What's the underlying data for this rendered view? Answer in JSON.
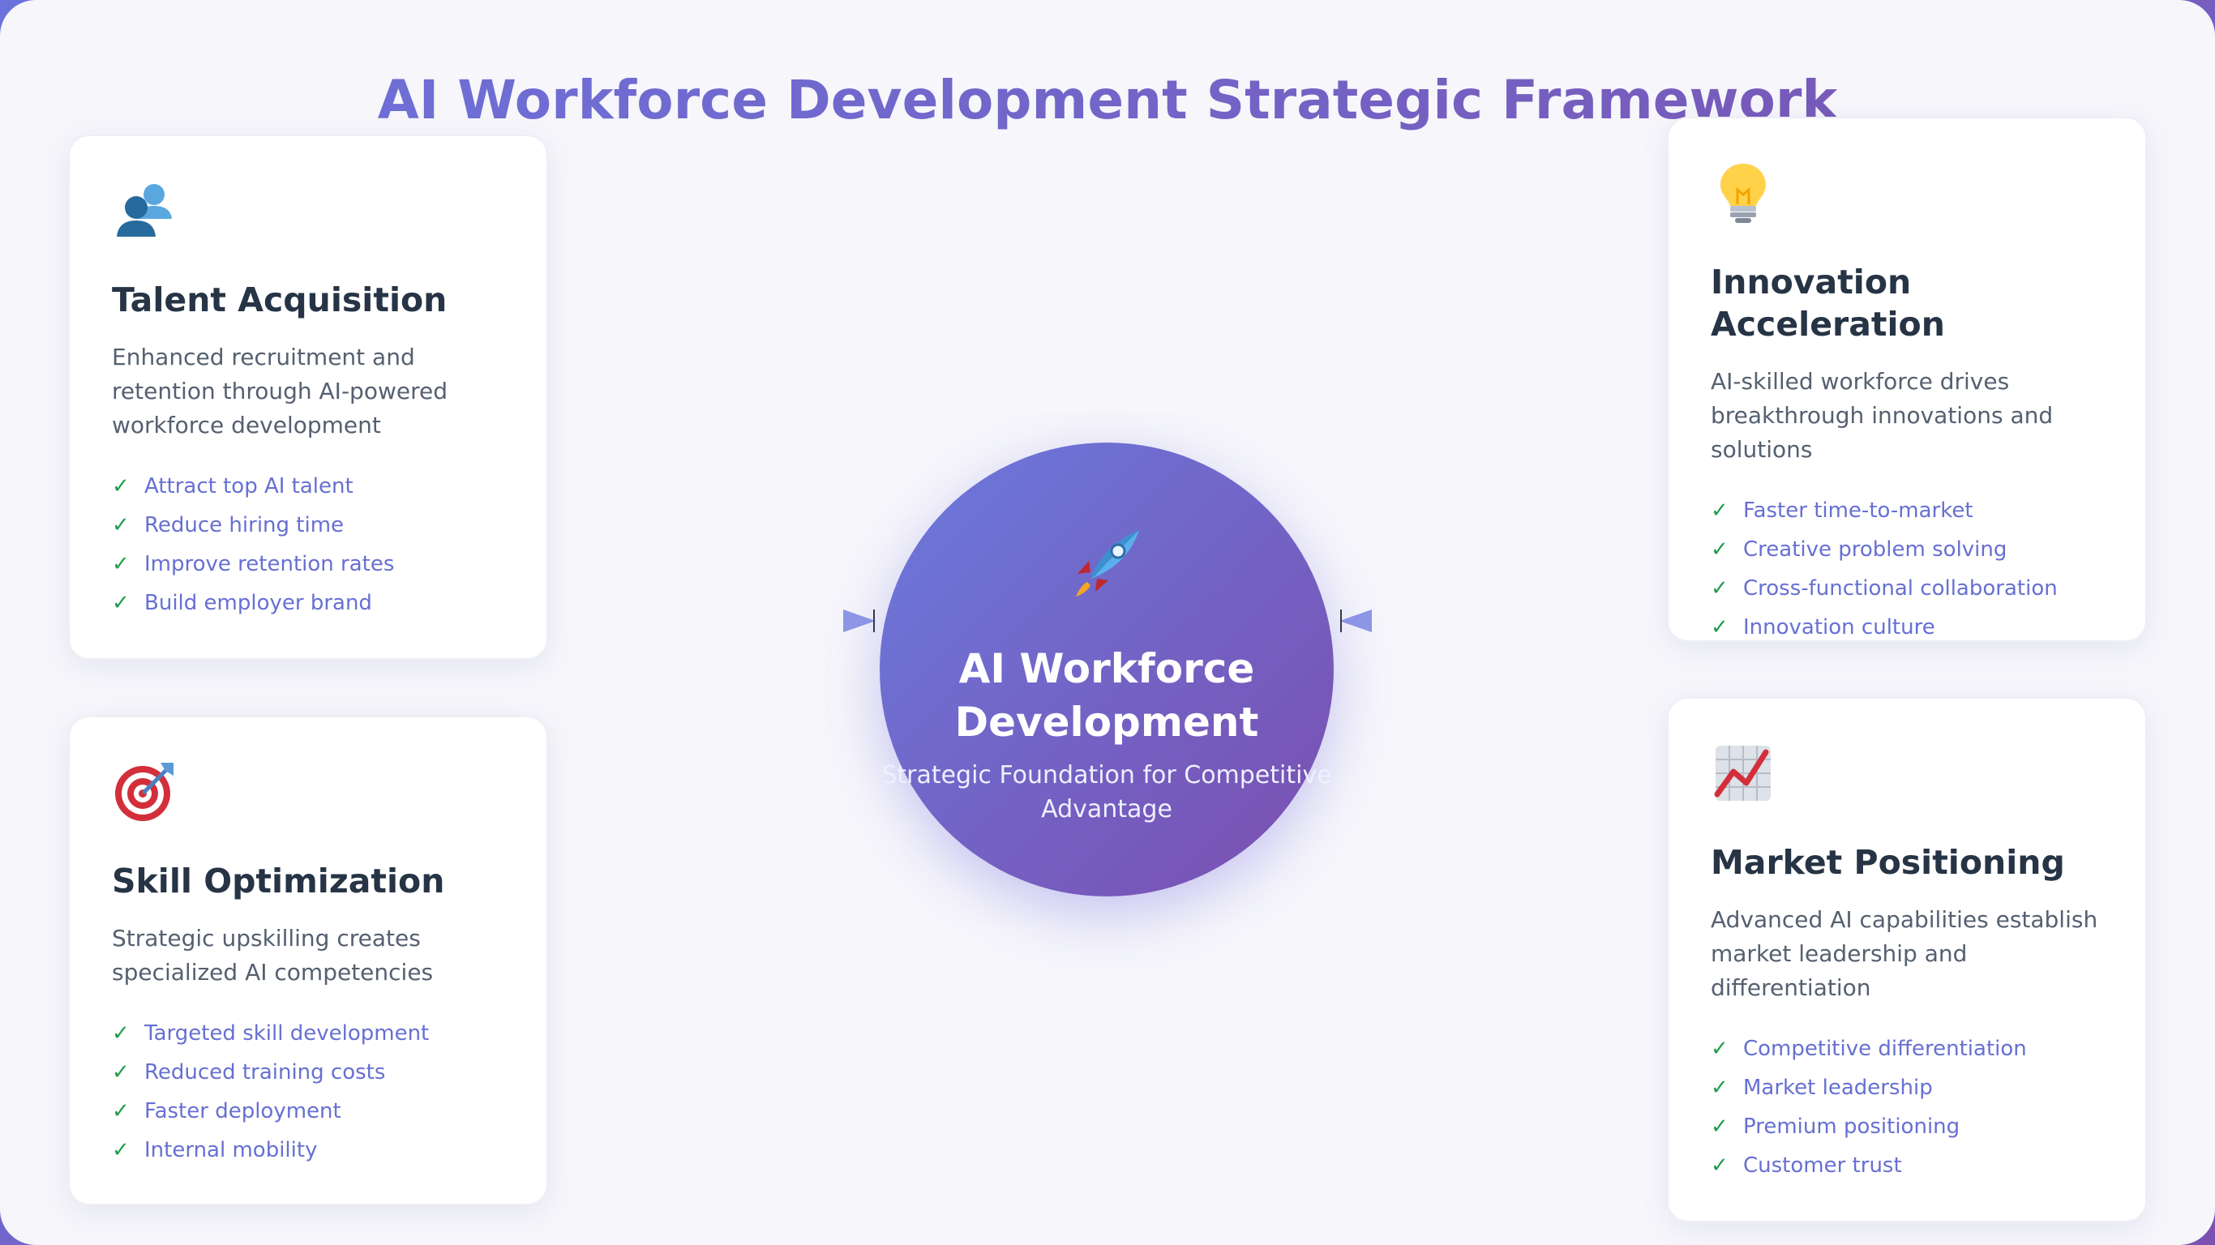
{
  "title": "AI Workforce Development Strategic Framework",
  "center": {
    "title_line1": "AI Workforce",
    "title_line2": "Development",
    "subtitle_line1": "Strategic Foundation for Competitive",
    "subtitle_line2": "Advantage",
    "icon": "rocket-icon"
  },
  "cards": {
    "talent": {
      "icon": "people-icon",
      "title": "Talent Acquisition",
      "description": "Enhanced recruitment and retention through AI-powered workforce development",
      "items": [
        "Attract top AI talent",
        "Reduce hiring time",
        "Improve retention rates",
        "Build employer brand"
      ]
    },
    "skill": {
      "icon": "target-icon",
      "title": "Skill Optimization",
      "description": "Strategic upskilling creates specialized AI competencies",
      "items": [
        "Targeted skill development",
        "Reduced training costs",
        "Faster deployment",
        "Internal mobility"
      ]
    },
    "innovation": {
      "icon": "lightbulb-icon",
      "title": "Innovation Acceleration",
      "description": "AI-skilled workforce drives breakthrough innovations and solutions",
      "items": [
        "Faster time-to-market",
        "Creative problem solving",
        "Cross-functional collaboration",
        "Innovation culture"
      ]
    },
    "market": {
      "icon": "chart-up-icon",
      "title": "Market Positioning",
      "description": "Advanced AI capabilities establish market leadership and differentiation",
      "items": [
        "Competitive differentiation",
        "Market leadership",
        "Premium positioning",
        "Customer trust"
      ]
    }
  },
  "check_symbol": "✓",
  "colors": {
    "accent": "#6b74dd",
    "accent_dark": "#7a4eae",
    "heading": "#263445",
    "check": "#1e9e4a"
  }
}
